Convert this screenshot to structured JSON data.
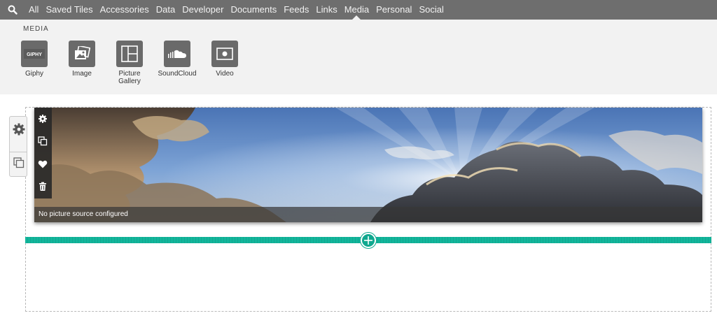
{
  "nav": {
    "search_icon": "search-icon",
    "tabs": [
      {
        "label": "All"
      },
      {
        "label": "Saved Tiles"
      },
      {
        "label": "Accessories"
      },
      {
        "label": "Data"
      },
      {
        "label": "Developer"
      },
      {
        "label": "Documents"
      },
      {
        "label": "Feeds"
      },
      {
        "label": "Links"
      },
      {
        "label": "Media",
        "active": true
      },
      {
        "label": "Personal"
      },
      {
        "label": "Social"
      }
    ]
  },
  "panel": {
    "title": "MEDIA",
    "tiles": [
      {
        "label": "Giphy",
        "badge": "GIPHY",
        "icon": "giphy-icon"
      },
      {
        "label": "Image",
        "icon": "image-icon"
      },
      {
        "label": "Picture Gallery",
        "icon": "gallery-icon"
      },
      {
        "label": "SoundCloud",
        "icon": "soundcloud-icon"
      },
      {
        "label": "Video",
        "icon": "video-icon"
      }
    ]
  },
  "editor": {
    "caption": "No picture source configured",
    "toolbar": [
      "gear-icon",
      "copy-icon",
      "heart-icon",
      "trash-icon"
    ],
    "side_handle": [
      "gear-icon",
      "copy-icon"
    ],
    "add_button": "plus-icon"
  },
  "colors": {
    "nav_bg": "#6e6e6e",
    "panel_bg": "#f2f2f2",
    "accent": "#12b59b"
  }
}
